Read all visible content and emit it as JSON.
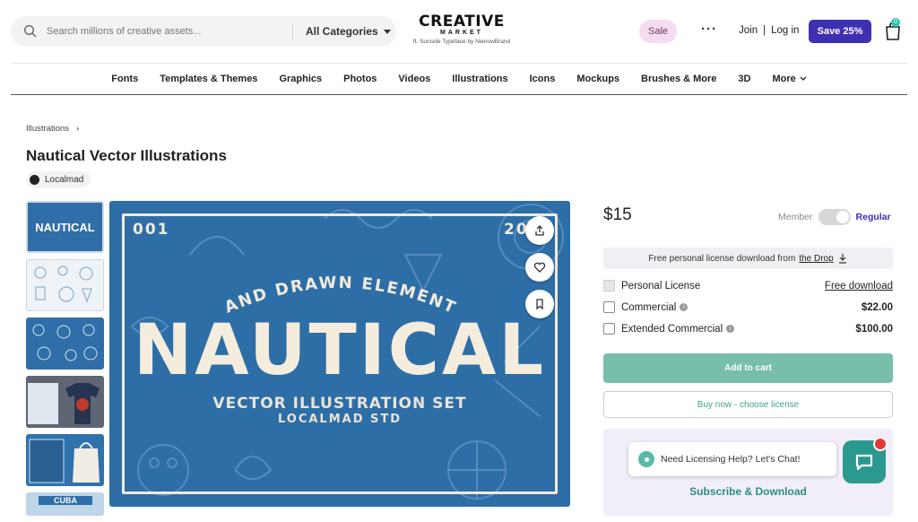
{
  "header": {
    "search_placeholder": "Search millions of creative assets...",
    "category_label": "All Categories",
    "logo_line1": "CREATIVE",
    "logo_line2": "MARKET",
    "logo_credit": "ft. Sunside Typeface by NienowBrand",
    "sale_label": "Sale",
    "more_dots": "···",
    "join_label": "Join",
    "sep": "|",
    "login_label": "Log in",
    "save_label": "Save 25%",
    "cart_count": "0"
  },
  "nav": {
    "items": [
      "Fonts",
      "Templates & Themes",
      "Graphics",
      "Photos",
      "Videos",
      "Illustrations",
      "Icons",
      "Mockups",
      "Brushes & More",
      "3D",
      "More"
    ]
  },
  "breadcrumb": {
    "item": "Illustrations",
    "arrow": "›"
  },
  "product": {
    "title": "Nautical Vector Illustrations",
    "author": "Localmad",
    "thumb1_text": "NAUTICAL",
    "thumb6_text": "CUBA"
  },
  "hero": {
    "num_left": "001",
    "num_right": "20",
    "arc_text": "HAND DRAWN ELEMENTS",
    "big_text": "NAUTICAL",
    "sub1": "VECTOR ILLUSTRATION SET",
    "sub2": "LOCALMAD STD"
  },
  "purchase": {
    "price": "$15",
    "member_label": "Member",
    "regular_label": "Regular",
    "drop_text": "Free personal license download from",
    "drop_link": "the Drop",
    "licenses": [
      {
        "label": "Personal License",
        "value": "Free download"
      },
      {
        "label": "Commercial",
        "value": "$22.00"
      },
      {
        "label": "Extended Commercial",
        "value": "$100.00"
      }
    ],
    "add_to_cart": "Add to cart",
    "buy_now": "Buy now - choose license",
    "chat_text": "Need Licensing Help? Let's Chat!",
    "subscribe": "Subscribe & Download"
  },
  "colors": {
    "accent": "#3f2fb3",
    "teal": "#78bfab",
    "hero_bg": "#2d6ea7",
    "sale_bg": "#f6dcf1"
  }
}
